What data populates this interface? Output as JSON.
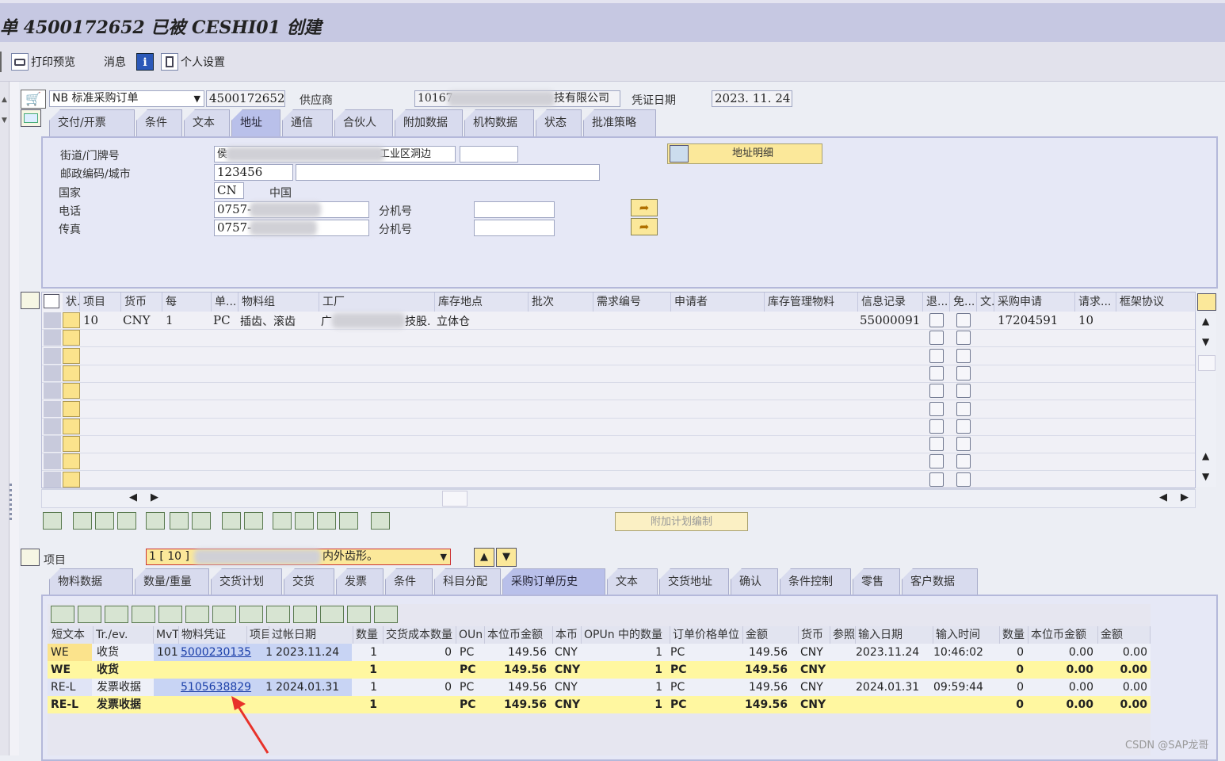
{
  "title": "单 4500172652 已被 CESHI01 创建",
  "toolbar": {
    "print_preview": "打印预览",
    "messages": "消息",
    "personal_settings": "个人设置"
  },
  "header": {
    "order_type": "NB 标准采购订单",
    "po_number": "4500172652",
    "vendor_label": "供应商",
    "vendor_value_prefix": "10167",
    "vendor_value_suffix": "技有限公司",
    "doc_date_label": "凭证日期",
    "doc_date": "2023. 11. 24"
  },
  "header_tabs": [
    "交付/开票",
    "条件",
    "文本",
    "地址",
    "通信",
    "合伙人",
    "附加数据",
    "机构数据",
    "状态",
    "批准策略"
  ],
  "header_active_tab": "地址",
  "address": {
    "street_label": "街道/门牌号",
    "street_value_suffix": "工业区洞边",
    "postal_label": "邮政编码/城市",
    "postal_value": "123456",
    "country_label": "国家",
    "country_code": "CN",
    "country_name": "中国",
    "phone_label": "电话",
    "phone_value": "0757-",
    "fax_label": "传真",
    "fax_value": "0757-",
    "ext_label": "分机号",
    "address_detail_button": "地址明细"
  },
  "items_grid": {
    "columns": [
      "状.",
      "项目",
      "货币",
      "每",
      "单...",
      "物料组",
      "工厂",
      "库存地点",
      "批次",
      "需求编号",
      "申请者",
      "库存管理物料",
      "信息记录",
      "退...",
      "免...",
      "文.",
      "采购申请",
      "请求...",
      "框架协议"
    ],
    "row": {
      "item": "10",
      "currency": "CNY",
      "per": "1",
      "unit": "PC",
      "material_group": "插齿、滚齿",
      "plant_prefix": "广",
      "plant_suffix": "技股.",
      "storage": "立体仓",
      "info_record": "55000091",
      "pr": "17204591",
      "pr_item": "10"
    }
  },
  "schedule_button": "附加计划编制",
  "item_selector": {
    "label": "项目",
    "value": "1 [ 10 ]",
    "desc": "内外齿形。"
  },
  "item_tabs": [
    "物料数据",
    "数量/重量",
    "交货计划",
    "交货",
    "发票",
    "条件",
    "科目分配",
    "采购订单历史",
    "文本",
    "交货地址",
    "确认",
    "条件控制",
    "零售",
    "客户数据"
  ],
  "item_active_tab": "采购订单历史",
  "history": {
    "columns": [
      "短文本",
      "Tr./ev.",
      "MvT",
      "物料凭证",
      "项目",
      "过帐日期",
      "数量",
      "交货成本数量",
      "OUn",
      "本位币金额",
      "本币",
      "OPUn 中的数量",
      "订单价格单位",
      "金额",
      "货币",
      "参照",
      "输入日期",
      "输入时间",
      "数量",
      "本位币金额",
      "金额"
    ],
    "rows": [
      {
        "short": "WE",
        "trev": "收货",
        "mvt": "101",
        "doc": "5000230135",
        "item": "1",
        "date": "2023.11.24",
        "qty": "1",
        "dcq": "0",
        "oun": "PC",
        "amt": "149.56",
        "cur": "CNY",
        "opun_qty": "1",
        "opu": "PC",
        "amount": "149.56",
        "currency": "CNY",
        "entry_date": "2023.11.24",
        "entry_time": "10:46:02",
        "qty2": "0",
        "amt2": "0.00",
        "amt3": "0.00",
        "total": false
      },
      {
        "short": "WE",
        "trev": "收货",
        "mvt": "",
        "doc": "",
        "item": "",
        "date": "",
        "qty": "1",
        "dcq": "",
        "oun": "PC",
        "amt": "149.56",
        "cur": "CNY",
        "opun_qty": "1",
        "opu": "PC",
        "amount": "149.56",
        "currency": "CNY",
        "entry_date": "",
        "entry_time": "",
        "qty2": "0",
        "amt2": "0.00",
        "amt3": "0.00",
        "total": true
      },
      {
        "short": "RE-L",
        "trev": "发票收据",
        "mvt": "",
        "doc": "5105638829",
        "item": "1",
        "date": "2024.01.31",
        "qty": "1",
        "dcq": "0",
        "oun": "PC",
        "amt": "149.56",
        "cur": "CNY",
        "opun_qty": "1",
        "opu": "PC",
        "amount": "149.56",
        "currency": "CNY",
        "entry_date": "2024.01.31",
        "entry_time": "09:59:44",
        "qty2": "0",
        "amt2": "0.00",
        "amt3": "0.00",
        "total": false
      },
      {
        "short": "RE-L",
        "trev": "发票收据",
        "mvt": "",
        "doc": "",
        "item": "",
        "date": "",
        "qty": "1",
        "dcq": "",
        "oun": "PC",
        "amt": "149.56",
        "cur": "CNY",
        "opun_qty": "1",
        "opu": "PC",
        "amount": "149.56",
        "currency": "CNY",
        "entry_date": "",
        "entry_time": "",
        "qty2": "0",
        "amt2": "0.00",
        "amt3": "0.00",
        "total": true
      }
    ]
  },
  "watermark": "CSDN @SAP龙哥",
  "colors": {
    "accent_tab": "#b9c0ea",
    "total_row": "#fff7a0",
    "link": "#1a3ea8",
    "arrow": "#e8322a"
  }
}
